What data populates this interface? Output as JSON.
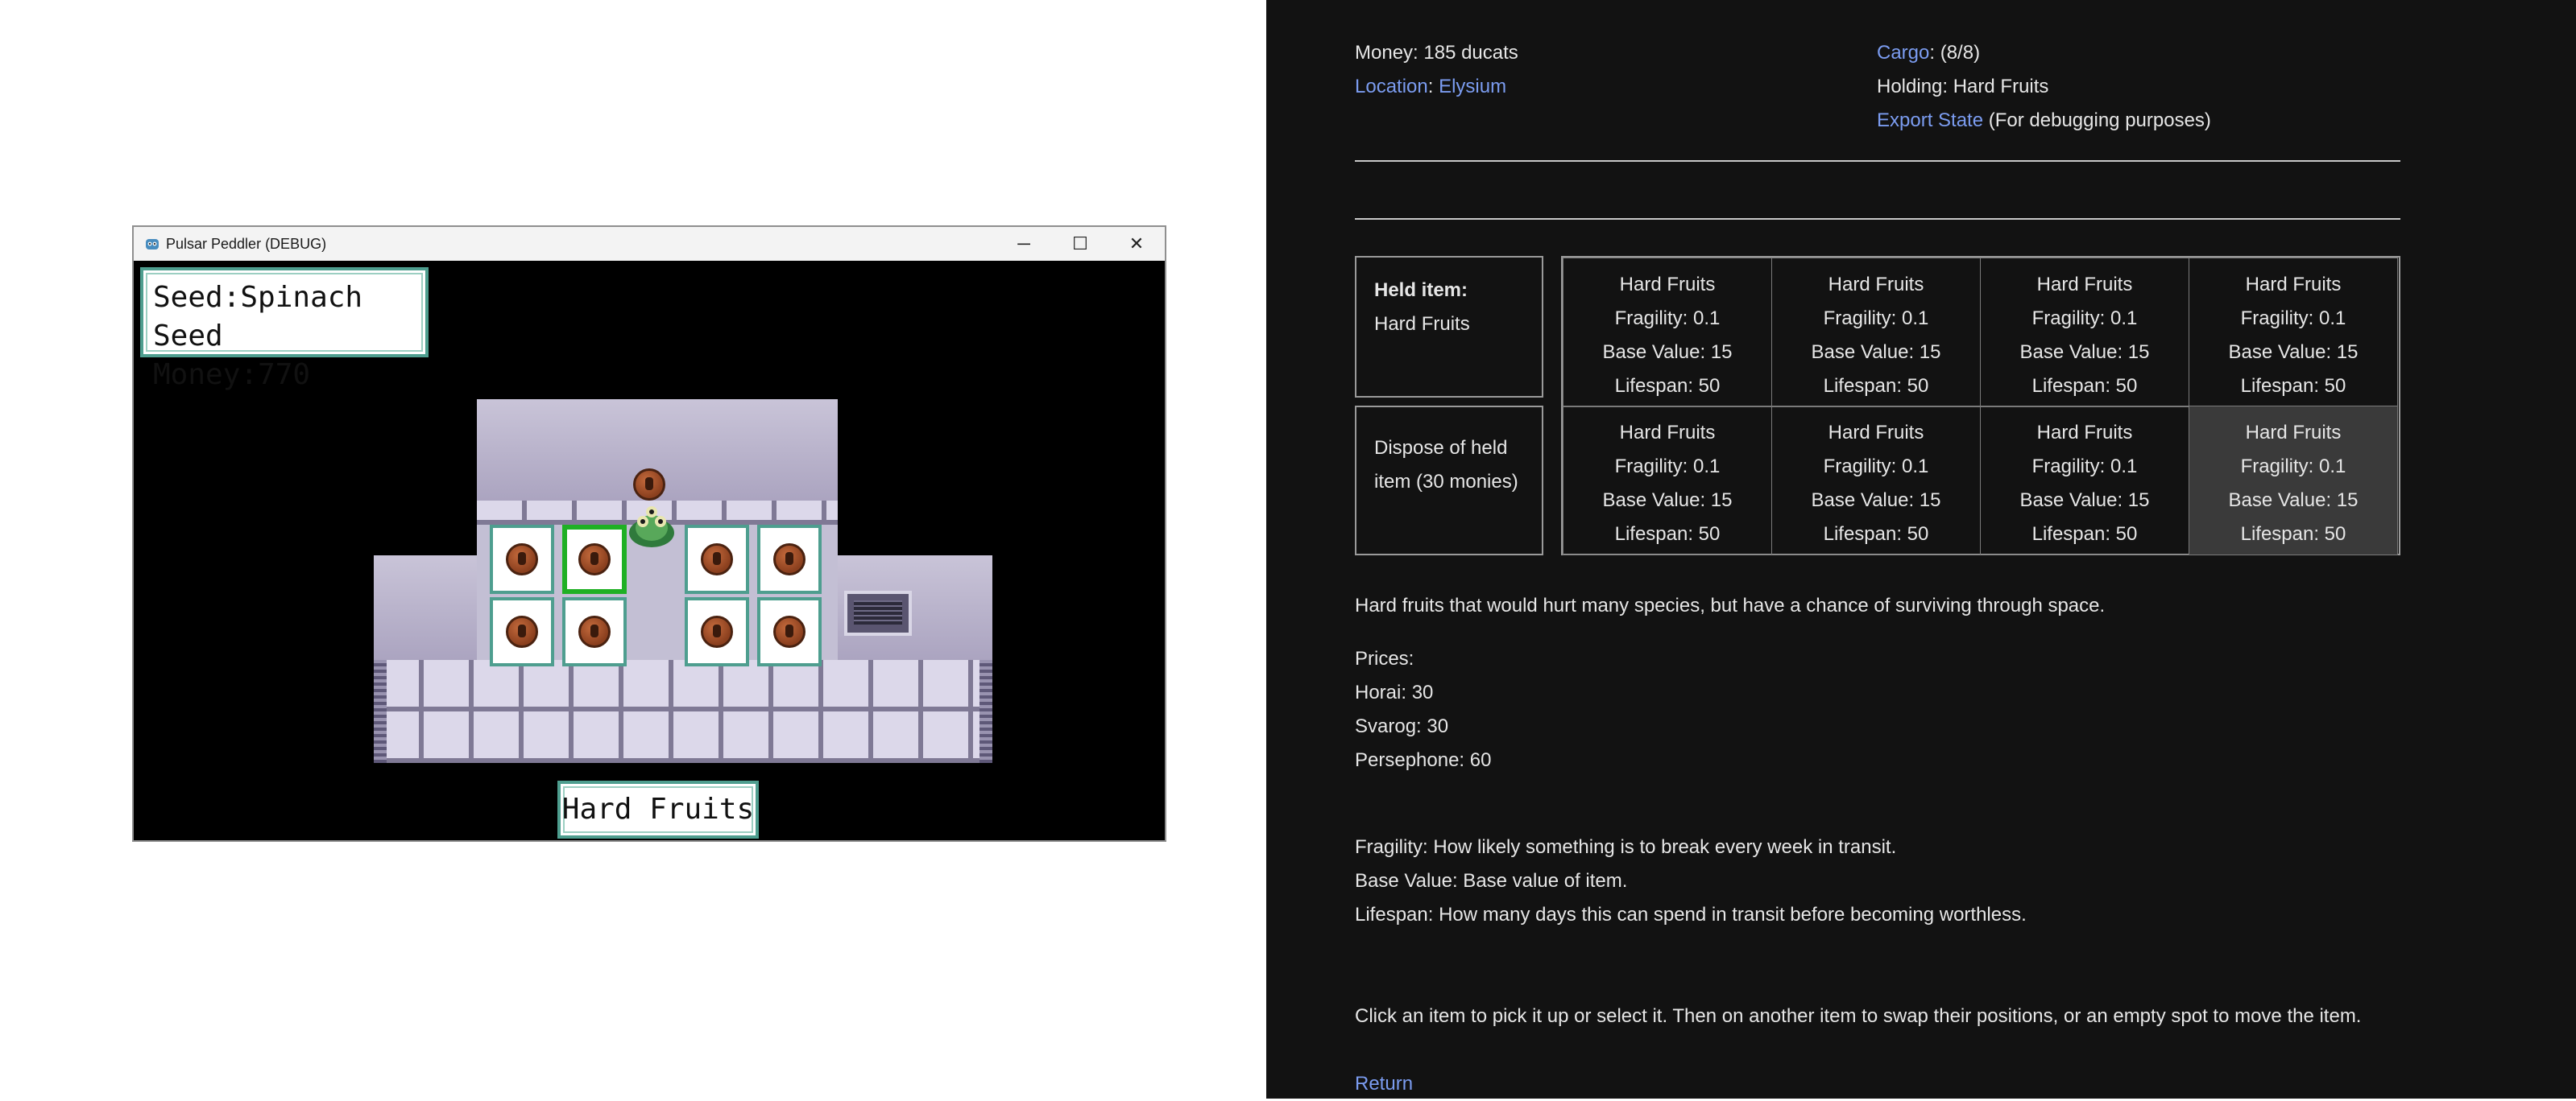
{
  "game_window": {
    "title": "Pulsar Peddler (DEBUG)",
    "controls": {
      "minimize": "─",
      "maximize": "☐",
      "close": "✕"
    },
    "hud": {
      "seed_line": "Seed:Spinach Seed",
      "money_line": "Money:770"
    },
    "held_label": "Hard Fruits",
    "icons": {
      "app": "godot-icon",
      "item": "fruit-icon"
    }
  },
  "panel": {
    "money": "Money: 185 ducats",
    "cargo_link": "Cargo",
    "cargo_value": ": (8/8)",
    "location_link": "Location",
    "location_sep": ": ",
    "location_value": "Elysium",
    "holding": "Holding: Hard Fruits",
    "export_link": "Export State",
    "export_note": " (For debugging purposes)",
    "held_item_heading": "Held item:",
    "held_item_name": "Hard Fruits",
    "dispose_line1": "Dispose of held",
    "dispose_line2": "item (30 monies)",
    "grid": [
      {
        "name": "Hard Fruits",
        "fragility": "Fragility: 0.1",
        "base_value": "Base Value: 15",
        "lifespan": "Lifespan: 50"
      },
      {
        "name": "Hard Fruits",
        "fragility": "Fragility: 0.1",
        "base_value": "Base Value: 15",
        "lifespan": "Lifespan: 50"
      },
      {
        "name": "Hard Fruits",
        "fragility": "Fragility: 0.1",
        "base_value": "Base Value: 15",
        "lifespan": "Lifespan: 50"
      },
      {
        "name": "Hard Fruits",
        "fragility": "Fragility: 0.1",
        "base_value": "Base Value: 15",
        "lifespan": "Lifespan: 50"
      },
      {
        "name": "Hard Fruits",
        "fragility": "Fragility: 0.1",
        "base_value": "Base Value: 15",
        "lifespan": "Lifespan: 50"
      },
      {
        "name": "Hard Fruits",
        "fragility": "Fragility: 0.1",
        "base_value": "Base Value: 15",
        "lifespan": "Lifespan: 50"
      },
      {
        "name": "Hard Fruits",
        "fragility": "Fragility: 0.1",
        "base_value": "Base Value: 15",
        "lifespan": "Lifespan: 50"
      },
      {
        "name": "Hard Fruits",
        "fragility": "Fragility: 0.1",
        "base_value": "Base Value: 15",
        "lifespan": "Lifespan: 50"
      }
    ],
    "description": "Hard fruits that would hurt many species, but have a chance of surviving through space.",
    "prices_heading": "Prices:",
    "prices": [
      "Horai: 30",
      "Svarog: 30",
      "Persephone: 60"
    ],
    "glossary": [
      "Fragility: How likely something is to break every week in transit.",
      "Base Value: Base value of item.",
      "Lifespan: How many days this can spend in transit before becoming worthless."
    ],
    "instructions": "Click an item to pick it up or select it. Then on another item to swap their positions, or an empty spot to move the item.",
    "return_link": "Return"
  }
}
